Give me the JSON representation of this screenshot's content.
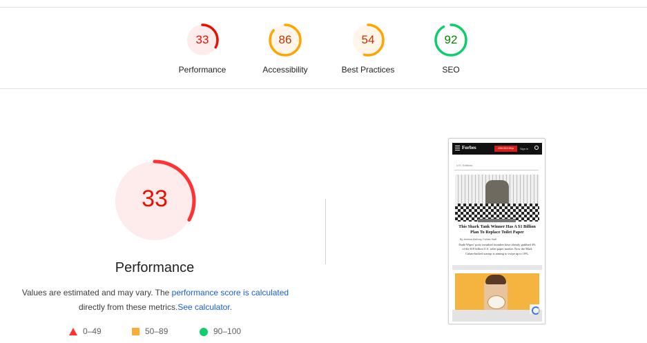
{
  "summary": {
    "gauges": [
      {
        "id": "performance",
        "score": "33",
        "label": "Performance",
        "fraction": 0.33,
        "color": "#eb0f00",
        "fill": "#fdeceb"
      },
      {
        "id": "accessibility",
        "score": "86",
        "label": "Accessibility",
        "fraction": 0.86,
        "color": "#ffa400",
        "fill": "#fff5e8"
      },
      {
        "id": "best-practices",
        "score": "54",
        "label": "Best Practices",
        "fraction": 0.54,
        "color": "#ffa400",
        "fill": "#fff5e8"
      },
      {
        "id": "seo",
        "score": "92",
        "label": "SEO",
        "fraction": 0.92,
        "color": "#0cce6b",
        "fill": "#ffffff"
      }
    ]
  },
  "performance": {
    "score": "33",
    "fraction": 0.33,
    "title": "Performance",
    "color": "#ff3333",
    "fill": "#fdeceb",
    "desc_prefix": "Values are estimated and may vary. The ",
    "desc_link": "performance score is calculated",
    "desc_mid": "directly from these metrics.",
    "desc_calc_link": "See calculator",
    "desc_suffix": "."
  },
  "legend": [
    {
      "range": "0–49",
      "shape": "triangle",
      "color": "#ff3333"
    },
    {
      "range": "50–89",
      "shape": "square",
      "color": "#ffaa33"
    },
    {
      "range": "90–100",
      "shape": "circle",
      "color": "#0cce6b"
    }
  ],
  "screenshot": {
    "logo": "Forbes",
    "join": "JOIN $19.99/yr",
    "sign_in": "Sign in",
    "editors": "U.S. Editions",
    "headline": "This Shark Tank Winner Has A $1 Billion Plan To Replace Toilet Paper",
    "byline": "By Jemima McEvoy, Forbes Staff",
    "body": "Dude Wipes’ potty mouthed founders have already grabbed 4% of the $10 billion U.S. toilet paper market. Now the Mark Cuban-backed startup is aiming to swipe up to 10%."
  }
}
